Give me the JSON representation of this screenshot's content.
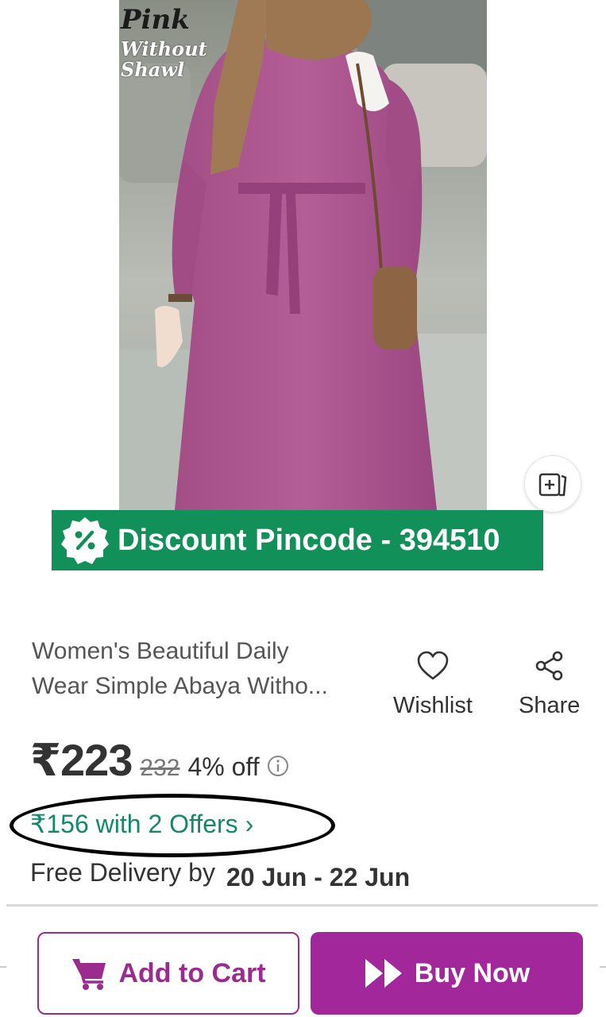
{
  "product_image": {
    "caption_line1": "Pink",
    "caption_line2": "Without",
    "caption_line3": "Shawl"
  },
  "banner": {
    "text": "Discount Pincode - 394510",
    "color": "#12905a"
  },
  "product": {
    "title_line1": "Women's Beautiful Daily",
    "title_line2": "Wear Simple Abaya Witho..."
  },
  "actions": {
    "wishlist_label": "Wishlist",
    "share_label": "Share"
  },
  "pricing": {
    "price": "₹223",
    "mrp": "232",
    "discount": "4% off",
    "offers_text": "₹156 with 2 Offers ›"
  },
  "delivery": {
    "label": "Free Delivery by",
    "dates": "20 Jun - 22 Jun"
  },
  "buttons": {
    "add_to_cart": "Add to Cart",
    "buy_now": "Buy Now"
  },
  "colors": {
    "accent": "#9c2b8f",
    "offer_green": "#13886b"
  },
  "icons": {
    "similar": "add-image-icon",
    "badge": "discount-percent-icon",
    "wishlist": "heart-icon",
    "share": "share-icon",
    "info": "info-icon",
    "cart": "cart-icon",
    "buy": "double-chevron-icon"
  }
}
